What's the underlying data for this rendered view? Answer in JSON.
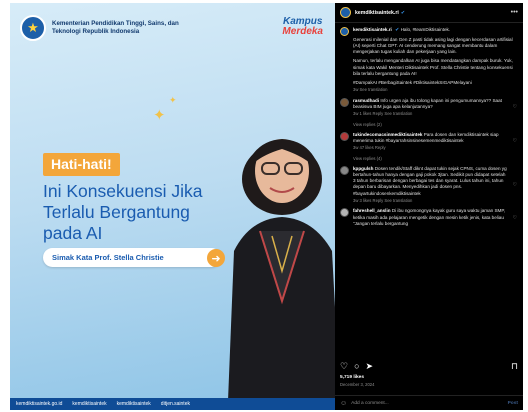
{
  "poster": {
    "ministry": "Kementerian Pendidikan Tinggi, Sains, dan Teknologi Republik Indonesia",
    "brand_top": "Kampus",
    "brand_bottom": "Merdeka",
    "badge": "Hati-hati!",
    "headline": "Ini Konsekuensi Jika Terlalu Bergantung pada AI",
    "cta": "Simak Kata Prof. Stella Christie",
    "footer": [
      "kemdiktisaintek.go.id",
      "kemdiktisaintek",
      "kemdiktisaintek",
      "ditjen.saintek"
    ],
    "colors": {
      "accent": "#f3a63a",
      "headline": "#1a5cb0",
      "footer": "#0f4c96"
    }
  },
  "panel": {
    "username": "kemdiktisaintek.ri",
    "caption_user": "kemdiktisaintek.ri",
    "caption_greeting": "Halo, #teamDiktisaintek.",
    "caption_p1": "Generasi milenial dan Gen Z pasti tidak asing lagi dengan kecerdasan artifisial (AI) seperti Chat GPT. AI cenderung memang sangat membantu dalam mengerjakan tugas kuliah dan pekerjaan yang lain.",
    "caption_p2": "Namun, terlalu mengandalkan AI juga bisa mendatangkan dampak buruk. Yuk, simak kata Wakil Menteri Diktisaintek Prof. Stella Christie tentang konsekuensi bila terlalu bergantung pada AI!",
    "caption_tags": "#DampakAI #BerbagiSaintek #DiktisaintekSIGAPMelayani",
    "caption_meta": "3w  See translation",
    "comments": [
      {
        "user": "rasmudhadi",
        "text": "Info urgen aja ibu tolong kapan ini pengumumannya?? Saat beasiswa BIM juga apa kelanjutannya?",
        "meta": "3w  1 likes  Reply  See translation",
        "replies": "View replies (2)"
      },
      {
        "user": "tukindecomacsinmediktisaintek",
        "text": "Para dosen dan kemdiktisaintek siap menerima tukin #bayarrahsinsinesemenmediktisaintek",
        "meta": "3w  47 likes  Reply",
        "replies": "View replies (4)"
      },
      {
        "user": "kppgulsh",
        "text": "Dosen tendik/Staff diknt dapat tukin sejak CPNS, cuma dosen yg bertahun-tahun hanya dengan gaji pokok 3jtan. Sedikit pun didapat setelah 3 tahun berbarisan dengan berbagai tes dan syarat. Lulus tahun ini, tahun depan baru dibayarkan. Menyedihkan jadi dosen pns. #bayartukindosenkemdiktisaintek",
        "meta": "3w  3 likes  Reply  See translation",
        "replies": ""
      },
      {
        "user": "fahreshell_anslin",
        "text": "Di ibu ngomongnya kayak guru saya waktu jaman SMP, ketika masih ada pelajaran mengetik dengan mesin ketik jenis, kata beliau \"Jangan terlalu bergantung",
        "meta": "",
        "replies": ""
      }
    ],
    "likes": "5,719 likes",
    "date": "December 3, 2024",
    "add_comment": "Add a comment...",
    "post_label": "Post"
  }
}
